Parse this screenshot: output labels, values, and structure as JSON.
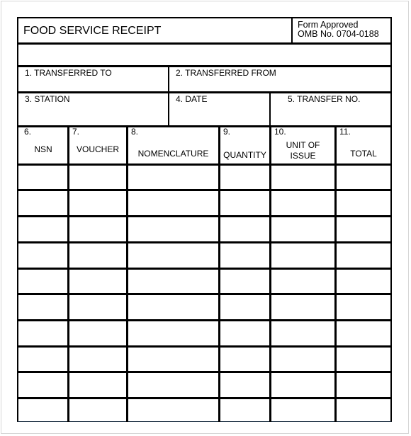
{
  "form": {
    "title": "FOOD SERVICE  RECEIPT",
    "approval_line1": "Form Approved",
    "approval_line2": "OMB No. 0704-0188"
  },
  "fields": {
    "transferred_to": "1. TRANSFERRED TO",
    "transferred_from": "2. TRANSFERRED FROM",
    "station": "3. STATION",
    "date": "4. DATE",
    "transfer_no": "5. TRANSFER NO."
  },
  "table": {
    "columns": [
      {
        "number": "6.",
        "label": "NSN"
      },
      {
        "number": "7.",
        "label": "VOUCHER"
      },
      {
        "number": "8.",
        "label": "NOMENCLATURE"
      },
      {
        "number": "9.",
        "label": "QUANTITY"
      },
      {
        "number": "10.",
        "label_line1": "UNIT OF",
        "label_line2": "ISSUE"
      },
      {
        "number": "11.",
        "label": "TOTAL"
      }
    ],
    "row_count": 10,
    "rows": [
      [
        "",
        "",
        "",
        "",
        "",
        ""
      ],
      [
        "",
        "",
        "",
        "",
        "",
        ""
      ],
      [
        "",
        "",
        "",
        "",
        "",
        ""
      ],
      [
        "",
        "",
        "",
        "",
        "",
        ""
      ],
      [
        "",
        "",
        "",
        "",
        "",
        ""
      ],
      [
        "",
        "",
        "",
        "",
        "",
        ""
      ],
      [
        "",
        "",
        "",
        "",
        "",
        ""
      ],
      [
        "",
        "",
        "",
        "",
        "",
        ""
      ],
      [
        "",
        "",
        "",
        "",
        "",
        ""
      ],
      [
        "",
        "",
        "",
        "",
        "",
        ""
      ]
    ]
  }
}
